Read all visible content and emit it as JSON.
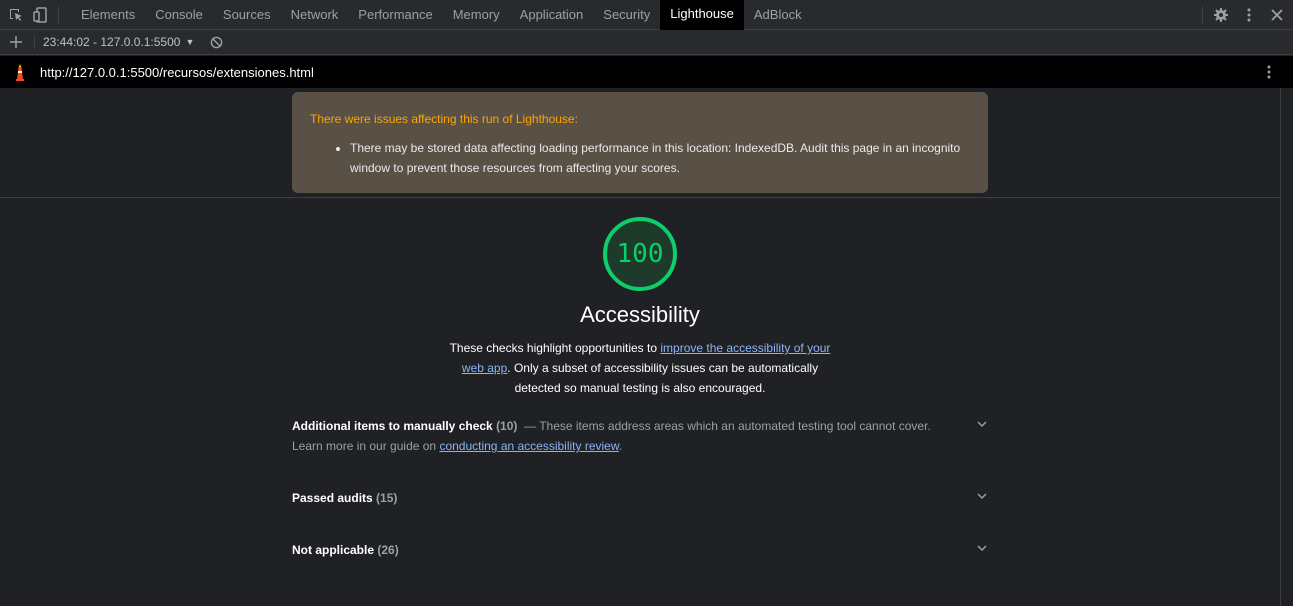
{
  "devtools": {
    "tabs": [
      "Elements",
      "Console",
      "Sources",
      "Network",
      "Performance",
      "Memory",
      "Application",
      "Security",
      "Lighthouse",
      "AdBlock"
    ],
    "active_tab": "Lighthouse"
  },
  "report_selector": {
    "value": "23:44:02 - 127.0.0.1:5500"
  },
  "url_bar": {
    "url": "http://127.0.0.1:5500/recursos/extensiones.html"
  },
  "warning": {
    "title": "There were issues affecting this run of Lighthouse:",
    "item": "There may be stored data affecting loading performance in this location: IndexedDB. Audit this page in an incognito window to prevent those resources from affecting your scores."
  },
  "category": {
    "score": "100",
    "title": "Accessibility",
    "desc_pre": "These checks highlight opportunities to ",
    "desc_link": "improve the accessibility of your web app",
    "desc_post": ". Only a subset of accessibility issues can be automatically detected so manual testing is also encouraged."
  },
  "groups": {
    "manual": {
      "title": "Additional items to manually check",
      "count": "(10)",
      "desc_pre": "These items address areas which an automated testing tool cannot cover. Learn more in our guide on ",
      "desc_link": "conducting an accessibility review",
      "desc_post": "."
    },
    "passed": {
      "title": "Passed audits",
      "count": "(15)"
    },
    "na": {
      "title": "Not applicable",
      "count": "(26)"
    }
  },
  "colors": {
    "pass_green": "#0cce6b",
    "warning_orange": "#ffa400",
    "link_blue": "#8ab4f8"
  }
}
